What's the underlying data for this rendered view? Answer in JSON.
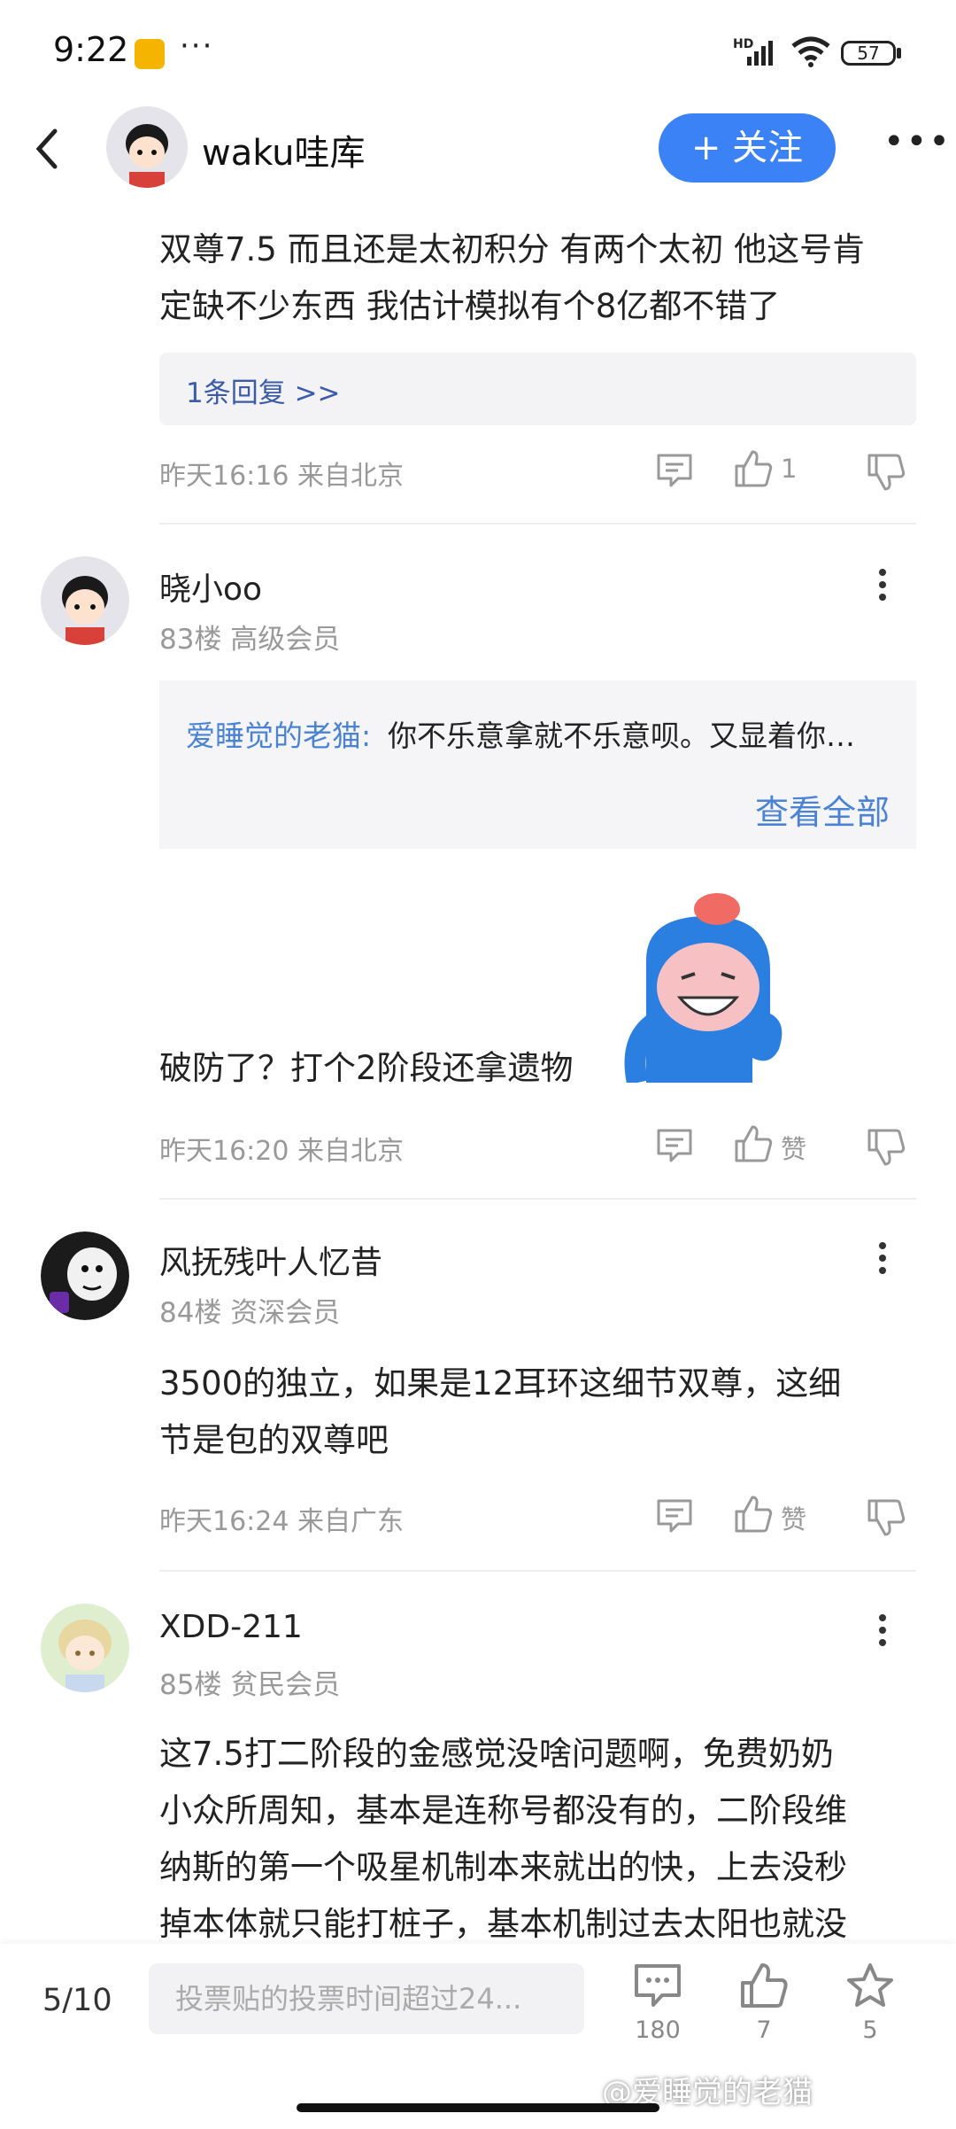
{
  "status_bar": {
    "time": "9:22",
    "dots": "···",
    "hd": "HD",
    "battery": "57"
  },
  "header": {
    "username": "waku哇库",
    "follow_label": "+ 关注",
    "more": "•••"
  },
  "post1": {
    "text_line1": "双尊7.5 而且还是太初积分 有两个太初 他这号肯",
    "text_line2": "定缺不少东西  我估计模拟有个8亿都不错了",
    "reply_link": "1条回复 >>",
    "meta": "昨天16:16 来自北京",
    "likes": "1"
  },
  "post2": {
    "username": "晓小oo",
    "floor": "83楼 高级会员",
    "quote_author": "爱睡觉的老猫:",
    "quote_text": "你不乐意拿就不乐意呗。又显着你…",
    "view_all": "查看全部",
    "text": "破防了？打个2阶段还拿遗物",
    "meta": "昨天16:20 来自北京",
    "likes": "赞"
  },
  "post3": {
    "username": "风抚残叶人忆昔",
    "floor": "84楼 资深会员",
    "text_line1": "3500的独立，如果是12耳环这细节双尊，这细",
    "text_line2": "节是包的双尊吧",
    "meta": "昨天16:24 来自广东",
    "likes": "赞"
  },
  "post4": {
    "username": "XDD-211",
    "floor": "85楼 贫民会员",
    "text_line1": "这7.5打二阶段的金感觉没啥问题啊，免费奶奶",
    "text_line2": "小众所周知，基本是连称号都没有的，二阶段维",
    "text_line3": "纳斯的第一个吸星机制本来就出的快，上去没秒",
    "text_line4": "掉本体就只能打桩子，基本机制过去太阳也就没"
  },
  "bottom_bar": {
    "page": "5/10",
    "input_placeholder": "投票贴的投票时间超过24...",
    "comments": "180",
    "likes": "7",
    "favorites": "5",
    "watermark": "@爱睡觉的老猫"
  },
  "colors": {
    "accent": "#3a82f6",
    "link": "#4a83d4"
  }
}
